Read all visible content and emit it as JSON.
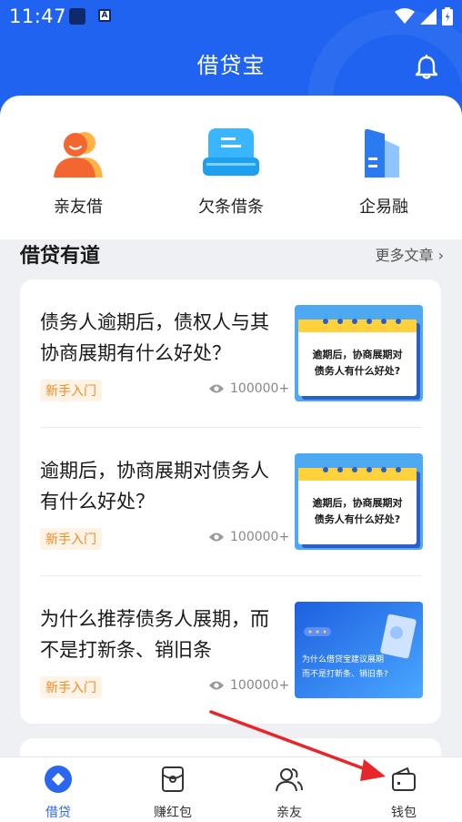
{
  "status": {
    "time": "11:47",
    "badge": "A"
  },
  "header": {
    "title": "借贷宝"
  },
  "services": [
    {
      "label": "亲友借"
    },
    {
      "label": "欠条借条"
    },
    {
      "label": "企易融"
    }
  ],
  "section": {
    "title": "借贷有道",
    "more": "更多文章 ›"
  },
  "articles": [
    {
      "title": "债务人逾期后，债权人与其协商展期有什么好处？",
      "tag": "新手入门",
      "views": "100000+",
      "thumb": "逾期后，协商展期对债务人有什么好处？"
    },
    {
      "title": "逾期后，协商展期对债务人有什么好处？",
      "tag": "新手入门",
      "views": "100000+",
      "thumb": "逾期后，协商展期对债务人有什么好处？"
    },
    {
      "title": "为什么推荐债务人展期，而不是打新条、销旧条",
      "tag": "新手入门",
      "views": "100000+",
      "thumb_line1": "为什么借贷宝建议展期",
      "thumb_line2": "而不是打新条、销旧条?"
    }
  ],
  "tabs": [
    {
      "label": "借贷"
    },
    {
      "label": "赚红包"
    },
    {
      "label": "亲友"
    },
    {
      "label": "钱包"
    }
  ],
  "colors": {
    "brand": "#1f63f0",
    "tag_text": "#f08a24",
    "tag_bg": "#fff3e6",
    "annotation": "#e8262a"
  }
}
